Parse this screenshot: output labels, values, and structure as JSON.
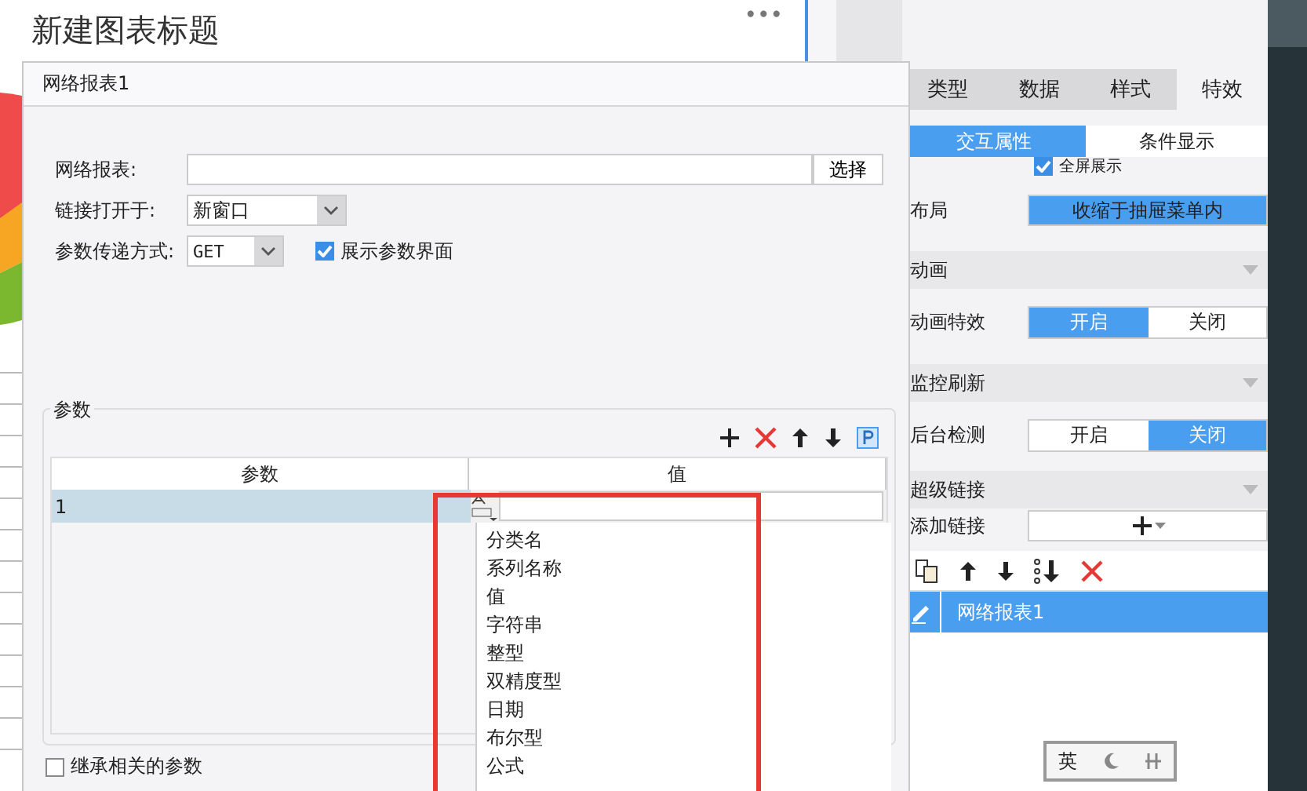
{
  "chart": {
    "title": "新建图表标题",
    "more": "•••"
  },
  "dialog": {
    "title": "网络报表1",
    "report_field": {
      "label": "网络报表:",
      "button": "选择"
    },
    "open_in": {
      "label": "链接打开于:",
      "value": "新窗口"
    },
    "method": {
      "label": "参数传递方式:",
      "value": "GET"
    },
    "show_params": {
      "label": "展示参数界面",
      "checked": true
    },
    "params": {
      "legend": "参数",
      "columns": [
        "参数",
        "值"
      ],
      "rows": [
        {
          "name": "1",
          "selected": true
        }
      ],
      "type_menu": [
        "分类名",
        "系列名称",
        "值",
        "字符串",
        "整型",
        "双精度型",
        "日期",
        "布尔型",
        "公式"
      ]
    },
    "inherit": {
      "label": "继承相关的参数",
      "checked": false
    }
  },
  "panel": {
    "tabs": [
      {
        "label": "类型",
        "selected": false
      },
      {
        "label": "数据",
        "selected": false
      },
      {
        "label": "样式",
        "selected": false
      },
      {
        "label": "特效",
        "selected": true
      }
    ],
    "subtabs": [
      {
        "label": "交互属性",
        "selected": true
      },
      {
        "label": "条件显示",
        "selected": false
      }
    ],
    "fullscreen": {
      "label": "全屏展示",
      "checked": true
    },
    "layout": {
      "label": "布局",
      "value": "收缩于抽屉菜单内"
    },
    "sections": [
      {
        "title": "动画",
        "rows": [
          {
            "label": "动画特效",
            "options": [
              {
                "label": "开启",
                "selected": true
              },
              {
                "label": "关闭",
                "selected": false
              }
            ]
          }
        ]
      },
      {
        "title": "监控刷新",
        "rows": [
          {
            "label": "后台检测",
            "options": [
              {
                "label": "开启",
                "selected": false
              },
              {
                "label": "关闭",
                "selected": true
              }
            ]
          }
        ]
      }
    ],
    "hyperlink": {
      "title": "超级链接",
      "add_label": "添加链接",
      "items": [
        {
          "label": "网络报表1",
          "selected": true
        }
      ]
    }
  },
  "ime": {
    "label": "英"
  }
}
